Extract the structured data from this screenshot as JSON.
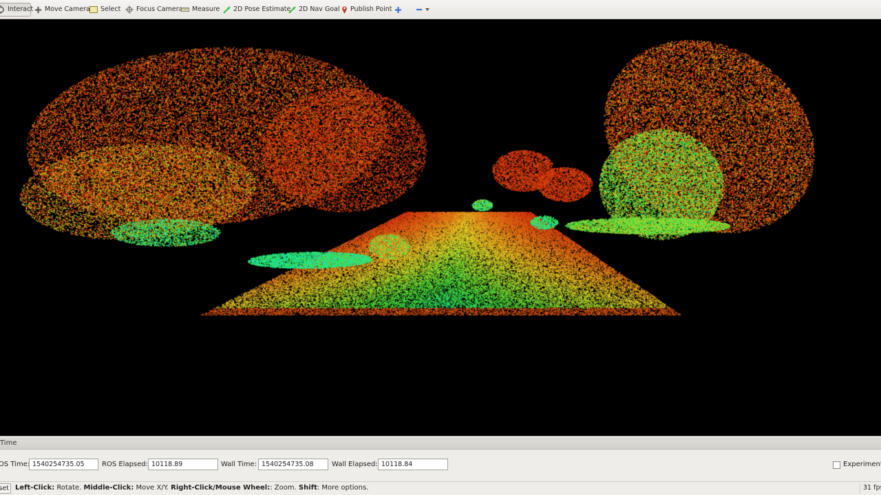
{
  "toolbar": {
    "tools": [
      {
        "label": "Interact",
        "icon": "interact-icon",
        "active": true
      },
      {
        "label": "Move Camera",
        "icon": "move-camera-icon"
      },
      {
        "label": "Select",
        "icon": "select-icon"
      },
      {
        "label": "Focus Camera",
        "icon": "focus-camera-icon"
      },
      {
        "label": "Measure",
        "icon": "measure-icon"
      },
      {
        "label": "2D Pose Estimate",
        "icon": "pose-estimate-icon"
      },
      {
        "label": "2D Nav Goal",
        "icon": "nav-goal-icon"
      },
      {
        "label": "Publish Point",
        "icon": "publish-point-icon"
      }
    ],
    "accent_green": "#3fbf3f",
    "accent_red": "#c0392b",
    "accent_blue": "#3b6fd6"
  },
  "viewport": {
    "content": "lidar point cloud, colored by intensity (red-yellow-green-cyan)",
    "background": "#000000"
  },
  "time_panel": {
    "title": "Time",
    "ros_time_label": "OS Time:",
    "ros_time_value": "1540254735.05",
    "ros_elapsed_label": "ROS Elapsed:",
    "ros_elapsed_value": "10118.89",
    "wall_time_label": "Wall Time:",
    "wall_time_value": "1540254735.08",
    "wall_elapsed_label": "Wall Elapsed:",
    "wall_elapsed_value": "10118.84",
    "experimental_label": "Experiment",
    "experimental_checked": false
  },
  "status_bar": {
    "reset_label": "set",
    "hint_parts": [
      {
        "text": "Left-Click:",
        "bold": true
      },
      {
        "text": " Rotate. ",
        "bold": false
      },
      {
        "text": "Middle-Click:",
        "bold": true
      },
      {
        "text": " Move X/Y. ",
        "bold": false
      },
      {
        "text": "Right-Click/Mouse Wheel:",
        "bold": true
      },
      {
        "text": ": Zoom. ",
        "bold": false
      },
      {
        "text": "Shift",
        "bold": true
      },
      {
        "text": ": More options.",
        "bold": false
      }
    ],
    "fps": "31 fps"
  }
}
